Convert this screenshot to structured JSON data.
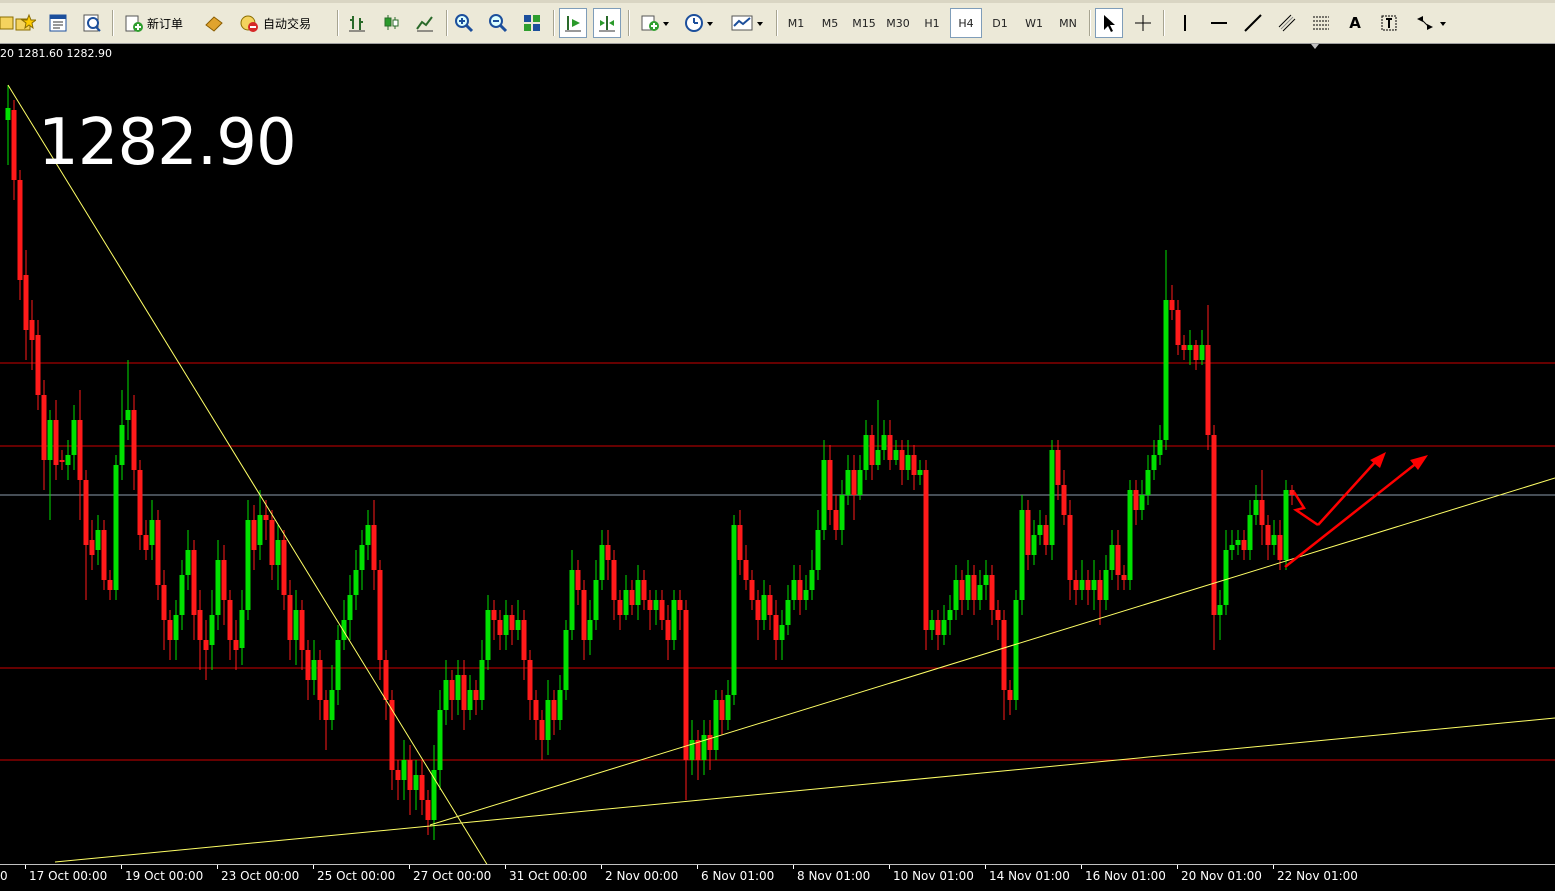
{
  "toolbar": {
    "new_order_label": "新订单",
    "auto_trade_label": "自动交易",
    "periods": [
      "M1",
      "M5",
      "M15",
      "M30",
      "H1",
      "H4",
      "D1",
      "W1",
      "MN"
    ],
    "active_period": "H4",
    "text_tool_label": "A"
  },
  "chart": {
    "ohlc_readout": "20 1281.60 1282.90",
    "current_price": "1282.90",
    "x_ticks": [
      "0",
      "17 Oct 00:00",
      "19 Oct 00:00",
      "23 Oct 00:00",
      "25 Oct 00:00",
      "27 Oct 00:00",
      "31 Oct 00:00",
      "2 Nov 00:00",
      "6 Nov 01:00",
      "8 Nov 01:00",
      "10 Nov 01:00",
      "14 Nov 01:00",
      "16 Nov 01:00",
      "20 Nov 01:00",
      "22 Nov 01:00"
    ],
    "colors": {
      "background": "#000000",
      "bull": "#00e000",
      "bear": "#ff1a1a",
      "trendline": "#ffff66",
      "hline": "#cc0000",
      "price_line": "#8c9bab",
      "arrow": "#ff0000"
    }
  },
  "chart_data": {
    "type": "candlestick",
    "title": "",
    "price_range": [
      1254,
      1308
    ]
  }
}
